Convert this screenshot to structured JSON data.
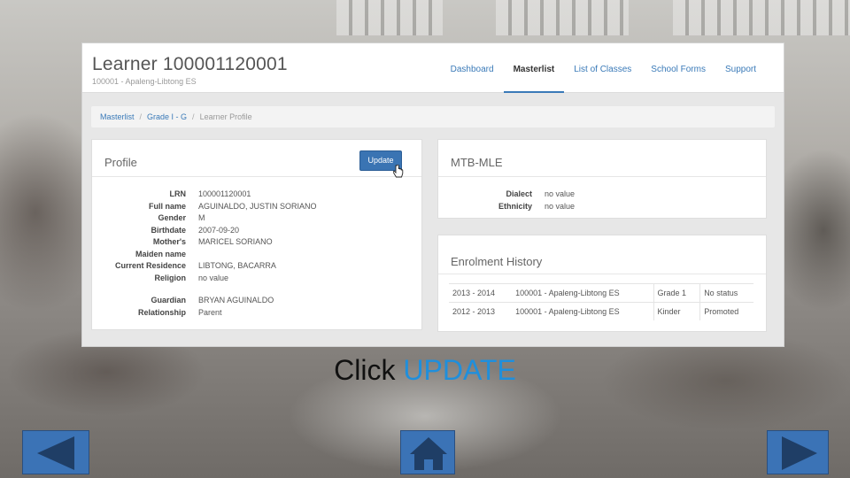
{
  "header": {
    "title": "Learner 100001120001",
    "subtitle": "100001 - Apaleng-Libtong ES",
    "nav": [
      "Dashboard",
      "Masterlist",
      "List of Classes",
      "School Forms",
      "Support"
    ]
  },
  "breadcrumb": [
    "Masterlist",
    "Grade I - G",
    "Learner Profile"
  ],
  "profile": {
    "title": "Profile",
    "update_label": "Update",
    "fields": [
      {
        "k": "LRN",
        "v": "100001120001"
      },
      {
        "k": "Full name",
        "v": "AGUINALDO, JUSTIN SORIANO"
      },
      {
        "k": "Gender",
        "v": "M"
      },
      {
        "k": "Birthdate",
        "v": "2007-09-20"
      },
      {
        "k": "Mother's",
        "v": "MARICEL SORIANO"
      },
      {
        "k": "Maiden name",
        "v": ""
      },
      {
        "k": "Current Residence",
        "v": "LIBTONG, BACARRA"
      },
      {
        "k": "Religion",
        "v": "no value"
      },
      {
        "k": "Guardian",
        "v": "BRYAN AGUINALDO"
      },
      {
        "k": "Relationship",
        "v": "Parent"
      }
    ]
  },
  "mtb": {
    "title": "MTB-MLE",
    "fields": [
      {
        "k": "Dialect",
        "v": "no value"
      },
      {
        "k": "Ethnicity",
        "v": "no value"
      }
    ]
  },
  "enrolment": {
    "title": "Enrolment History",
    "rows": [
      [
        "2013 - 2014",
        "100001 - Apaleng-Libtong ES",
        "Grade 1",
        "No status"
      ],
      [
        "2012 - 2013",
        "100001 - Apaleng-Libtong ES",
        "Kinder",
        "Promoted"
      ]
    ]
  },
  "caption": {
    "prefix": "Click",
    "highlight": "UPDATE"
  },
  "colors": {
    "accent": "#3a74b3",
    "highlight": "#1f8fdc"
  },
  "icons": {
    "back": "triangle-left-icon",
    "home": "home-icon",
    "next": "triangle-right-icon"
  }
}
